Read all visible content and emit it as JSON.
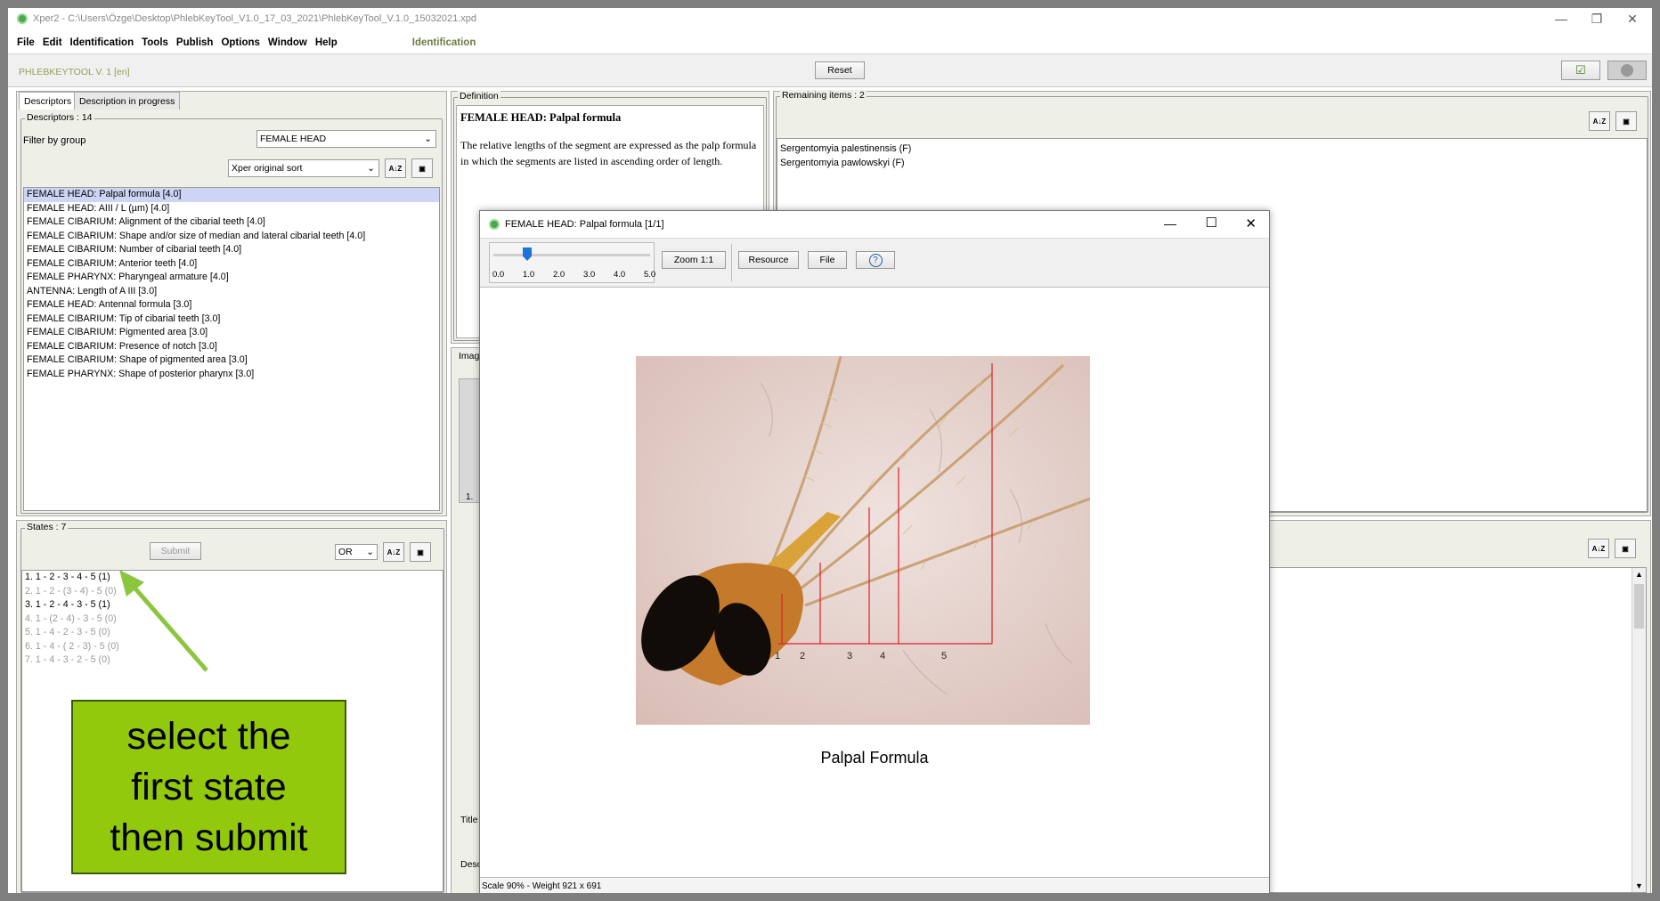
{
  "window": {
    "title": "Xper2 - C:\\Users\\Özge\\Desktop\\PhlebKeyTool_V1.0_17_03_2021\\PhlebKeyTool_V.1.0_15032021.xpd"
  },
  "menu": {
    "items": [
      "File",
      "Edit",
      "Identification",
      "Tools",
      "Publish",
      "Options",
      "Window",
      "Help"
    ],
    "current": "Identification"
  },
  "toolbar": {
    "app_name": "PHLEBKEYTOOL V. 1 [en]",
    "reset_label": "Reset"
  },
  "descriptors": {
    "tabs": [
      "Descriptors",
      "Description in progress"
    ],
    "group_label": "Descriptors : 14",
    "filter_label": "Filter by group",
    "filter_value": "FEMALE HEAD",
    "sort_value": "Xper original sort",
    "items": [
      "FEMALE HEAD: Palpal formula [4.0]",
      "FEMALE HEAD: AIII / L (µm) [4.0]",
      "FEMALE CIBARIUM: Alignment of the cibarial teeth [4.0]",
      "FEMALE CIBARIUM: Shape and/or size of median and lateral cibarial teeth [4.0]",
      "FEMALE CIBARIUM: Number of cibarial teeth [4.0]",
      "FEMALE CIBARIUM: Anterior teeth [4.0]",
      "FEMALE PHARYNX: Pharyngeal armature [4.0]",
      "ANTENNA: Length of A III  [3.0]",
      "FEMALE HEAD: Antennal formula [3.0]",
      "FEMALE CIBARIUM: Tip of cibarial teeth [3.0]",
      "FEMALE CIBARIUM: Pigmented area [3.0]",
      "FEMALE CIBARIUM: Presence of notch  [3.0]",
      "FEMALE CIBARIUM: Shape of pigmented area [3.0]",
      "FEMALE PHARYNX: Shape of posterior pharynx [3.0]"
    ]
  },
  "states": {
    "group_label": "States : 7",
    "submit_label": "Submit",
    "logic_value": "OR",
    "items": [
      {
        "text": "1. 1 - 2 - 3 - 4 - 5 (1)",
        "active": true
      },
      {
        "text": "2. 1 - 2 - (3 - 4) - 5 (0)",
        "active": false
      },
      {
        "text": "3. 1 - 2 - 4 - 3 - 5 (1)",
        "active": true
      },
      {
        "text": "4. 1 - (2 - 4) - 3 - 5 (0)",
        "active": false
      },
      {
        "text": "5. 1 - 4 - 2 - 3 - 5 (0)",
        "active": false
      },
      {
        "text": "6. 1 - 4 - ( 2 - 3) - 5 (0)",
        "active": false
      },
      {
        "text": "7. 1 - 4 - 3 - 2 - 5 (0)",
        "active": false
      }
    ]
  },
  "definition": {
    "group_label": "Definition",
    "heading": "FEMALE HEAD: Palpal formula",
    "body": "The relative lengths of the segment are expressed as the palp formula in which the segments are listed in ascending order of length."
  },
  "images_panel": {
    "label": "Imag",
    "index": "1.",
    "title_label": "Title",
    "desc_label": "Desc"
  },
  "remaining": {
    "group_label": "Remaining items : 2",
    "items": [
      "Sergentomyia palestinensis (F)",
      "Sergentomyia pawlowskyi (F)"
    ]
  },
  "dialog": {
    "title": "FEMALE HEAD: Palpal formula [1/1]",
    "zoom_ticks": [
      "0.0",
      "1.0",
      "2.0",
      "3.0",
      "4.0",
      "5.0"
    ],
    "zoom_value": 1.0,
    "zoom_button": "Zoom 1:1",
    "resource_button": "Resource",
    "file_button": "File",
    "help_button": "?",
    "caption": "Palpal Formula",
    "segment_labels": [
      "1",
      "2",
      "3",
      "4",
      "5"
    ],
    "status": "Scale 90%  -  Weight 921 x 691"
  },
  "annotation": {
    "lines": [
      "select the",
      "first state",
      "then submit"
    ]
  },
  "colors": {
    "accent": "#92c90d",
    "arrow": "#8cc63f",
    "selection": "#cdd4f4",
    "formula_lines": "#e0202a"
  }
}
